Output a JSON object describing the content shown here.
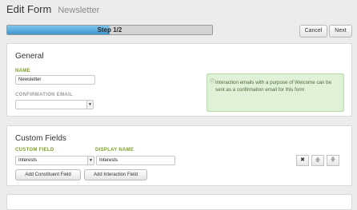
{
  "header": {
    "title": "Edit Form",
    "subtitle": "Newsletter"
  },
  "progress": {
    "label": "Step 1/2",
    "fraction": 0.5
  },
  "actions": {
    "cancel": "Cancel",
    "next": "Next"
  },
  "general": {
    "heading": "General",
    "name_label": "NAME",
    "name_value": "Newsletter",
    "confirmation_label": "CONFIRMATION EMAIL",
    "confirmation_value": "",
    "info_icon": "info-circle",
    "info_text": "Interaction emails with a purpose of Welcome can be sent as a confirmation email for this form"
  },
  "custom_fields": {
    "heading": "Custom Fields",
    "custom_field_label": "CUSTOM FIELD",
    "display_name_label": "DISPLAY NAME",
    "custom_field_value": "Interests",
    "display_name_value": "Interests",
    "add_constituent": "Add Constituent Field",
    "add_interaction": "Add Interaction Field",
    "row_actions": {
      "remove_icon": "close",
      "up_icon": "arrow-up",
      "down_icon": "arrow-down"
    }
  },
  "colors": {
    "accent_green": "#7aa123",
    "progress_blue": "#3f97cf",
    "info_bg": "#dff1d6"
  }
}
